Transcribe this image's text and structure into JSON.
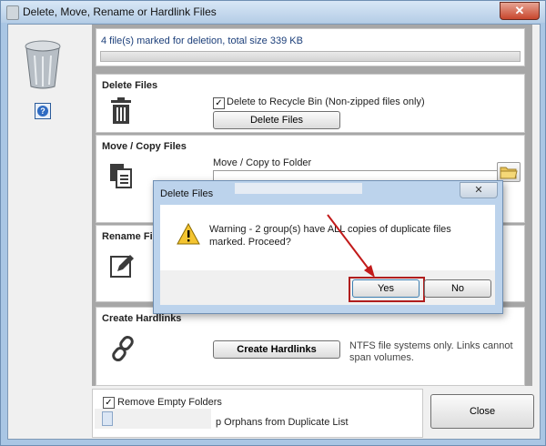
{
  "window": {
    "title": "Delete, Move, Rename or Hardlink Files",
    "close_glyph": "✕"
  },
  "info": {
    "text": "4 file(s) marked for deletion, total size 339 KB",
    "progress": 0
  },
  "delete": {
    "title": "Delete Files",
    "recycle_label": "Delete to Recycle Bin (Non-zipped files only)",
    "recycle_checked": true,
    "button": "Delete Files"
  },
  "move": {
    "title": "Move / Copy Files",
    "folder_label": "Move / Copy to Folder",
    "folder_value": ""
  },
  "rename": {
    "title": "Rename Files"
  },
  "hardlink": {
    "title": "Create Hardlinks",
    "button": "Create Hardlinks",
    "note": "NTFS file systems only.  Links cannot span volumes."
  },
  "options": {
    "remove_empty_label": "Remove Empty Folders",
    "remove_empty_checked": true,
    "orphans_label": "p Orphans from Duplicate List"
  },
  "close_button": "Close",
  "dialog": {
    "title": "Delete Files",
    "close_glyph": "✕",
    "message": "Warning - 2 group(s) have ALL copies of duplicate files marked. Proceed?",
    "yes": "Yes",
    "no": "No"
  },
  "colors": {
    "arrow": "#c21a1a",
    "highlight": "#b01e1e",
    "accent": "#1c3f7a"
  }
}
